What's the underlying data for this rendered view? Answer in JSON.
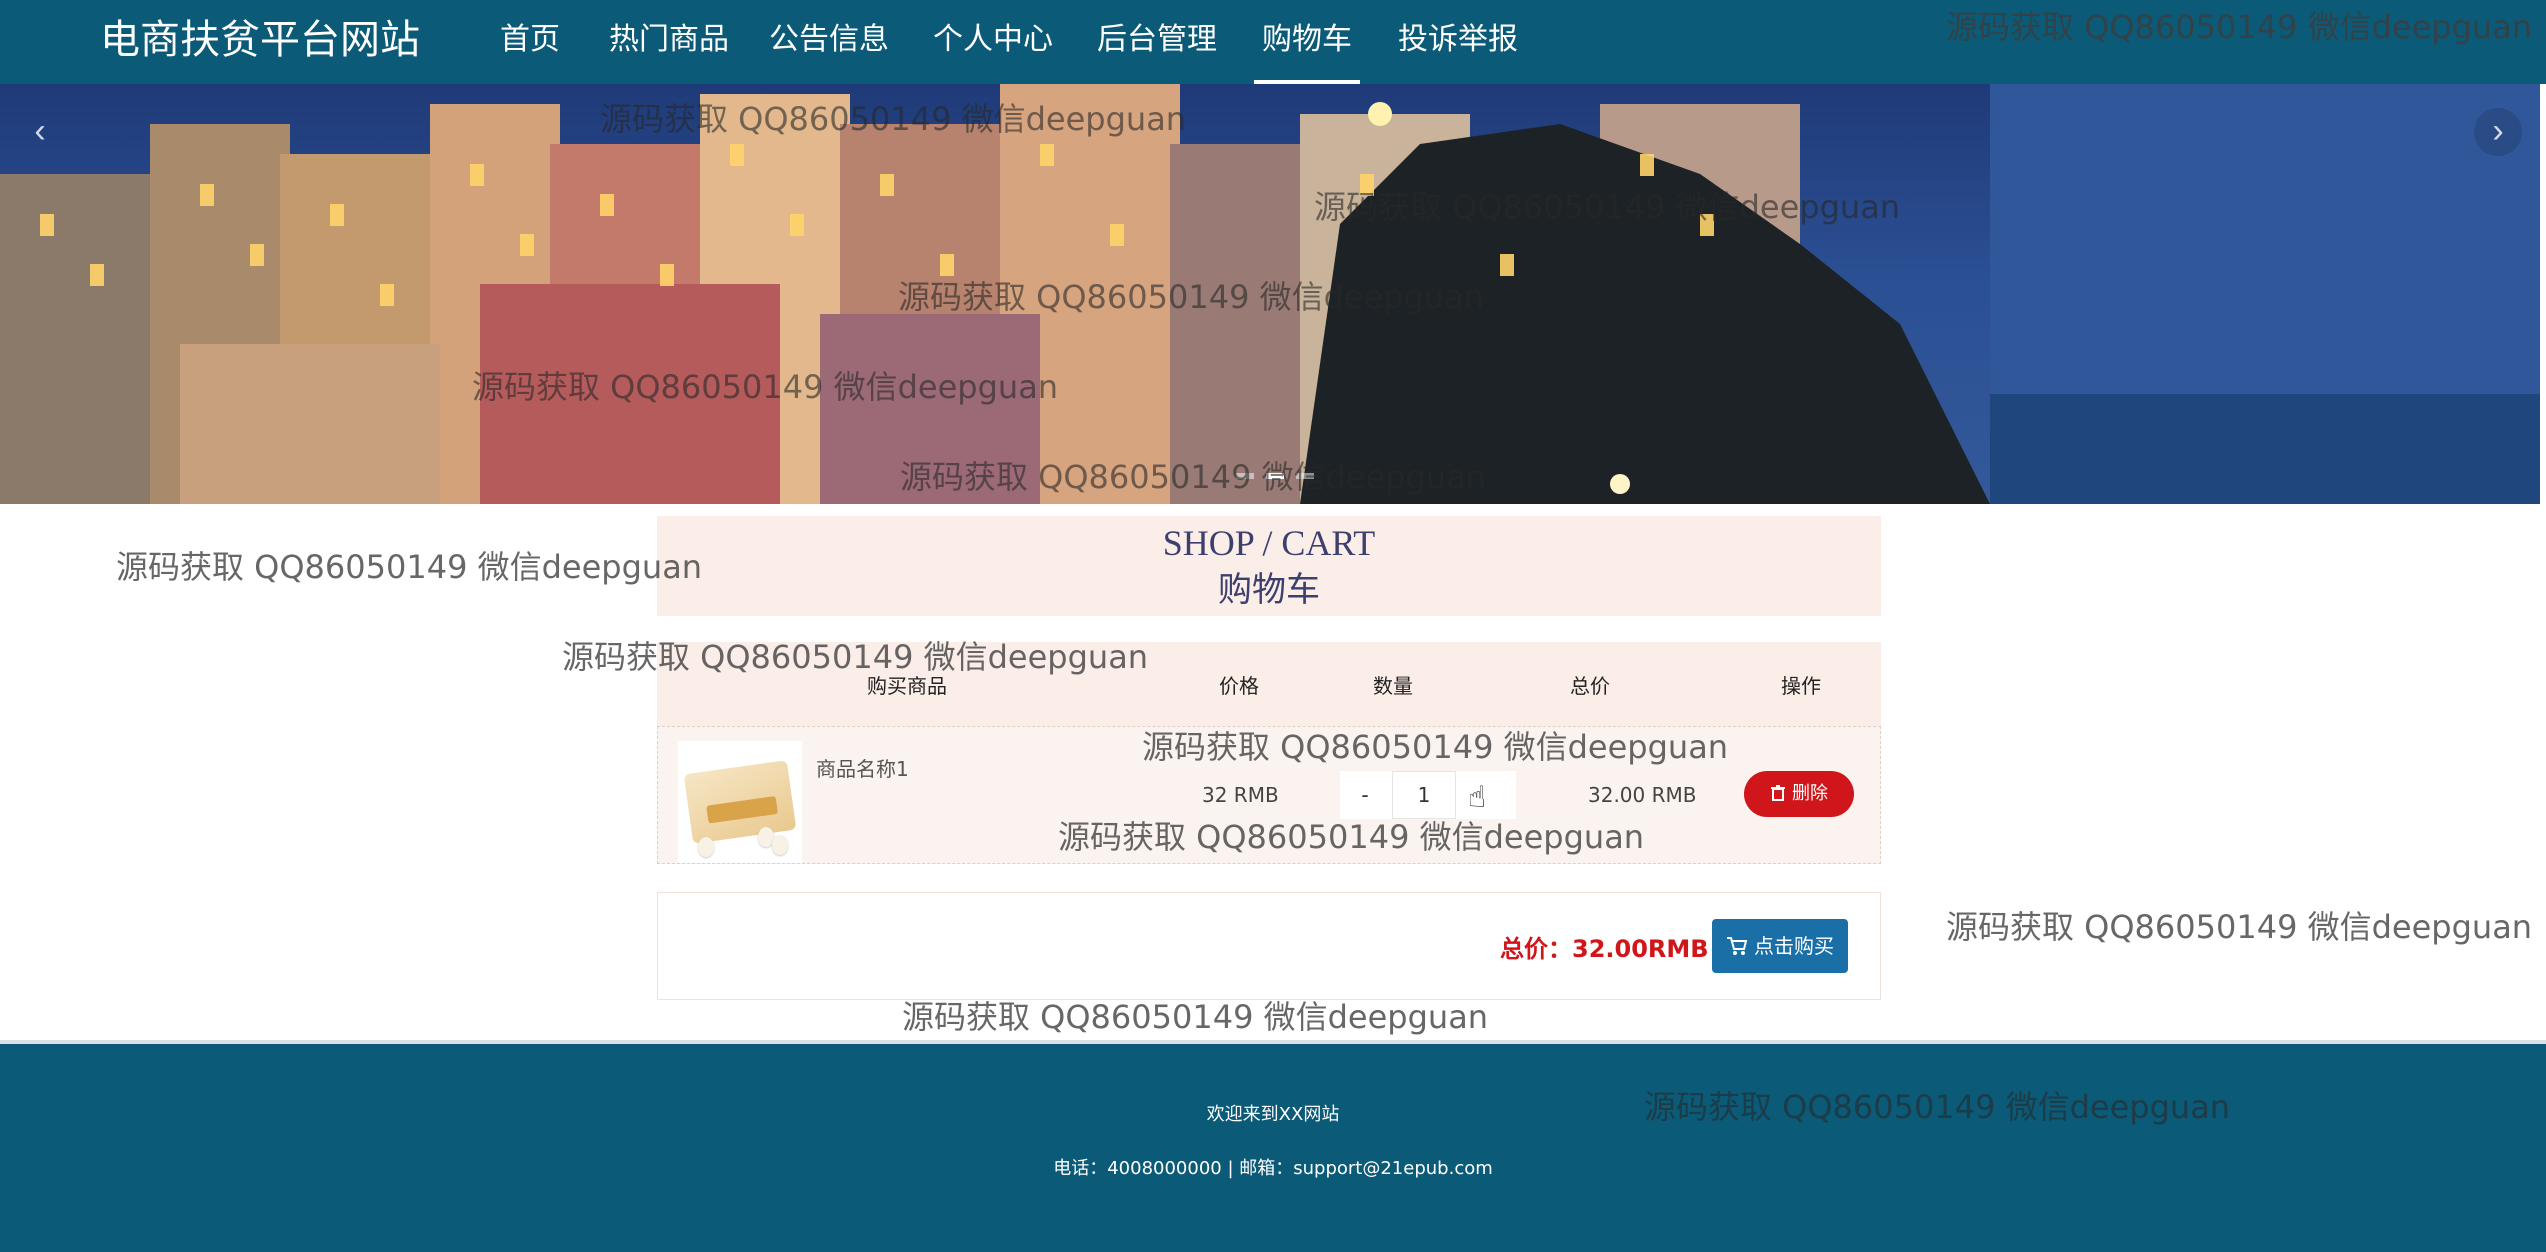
{
  "site": {
    "brand": "电商扶贫平台网站"
  },
  "nav": {
    "items": [
      {
        "label": "首页"
      },
      {
        "label": "热门商品"
      },
      {
        "label": "公告信息"
      },
      {
        "label": "个人中心"
      },
      {
        "label": "后台管理"
      },
      {
        "label": "购物车"
      },
      {
        "label": "投诉举报"
      }
    ],
    "active_index": 5
  },
  "banner": {
    "prev_icon": "chevron-left-icon",
    "next_icon": "chevron-right-icon",
    "prev_glyph": "‹",
    "next_glyph": "›",
    "slide_count": 3,
    "active_slide": 1
  },
  "cart": {
    "title_en": "SHOP / CART",
    "title_cn": "购物车",
    "headers": {
      "product": "购买商品",
      "price": "价格",
      "quantity": "数量",
      "total": "总价",
      "action": "操作"
    },
    "items": [
      {
        "name": "商品名称1",
        "price": "32 RMB",
        "quantity": "1",
        "minus_label": "-",
        "plus_label": "+",
        "total": "32.00 RMB",
        "delete_label": "删除",
        "delete_icon": "trash-icon"
      }
    ],
    "grand_total": "总价：32.00RMB",
    "buy_label": "点击购买",
    "buy_icon": "cart-icon"
  },
  "footer": {
    "welcome": "欢迎来到XX网站",
    "contact": "电话：4008000000 | 邮箱：support@21epub.com"
  },
  "watermark": "源码获取 QQ86050149 微信deepguan",
  "colors": {
    "nav_bg": "#0a5a78",
    "accent_red": "#d0161a",
    "buy_blue": "#1a6fa6",
    "cart_panel": "#fbeee8"
  }
}
